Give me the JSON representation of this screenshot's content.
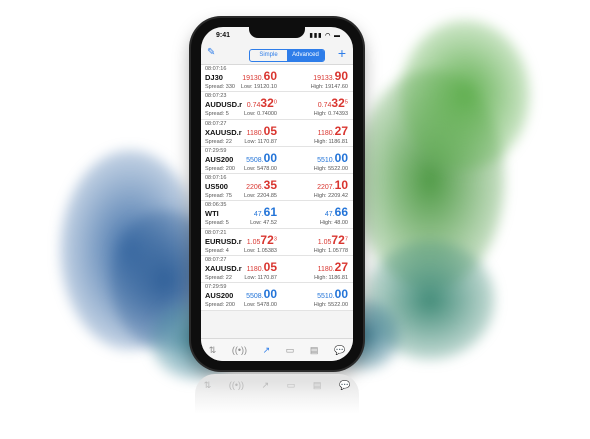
{
  "status": {
    "time": "9:41",
    "icons": "▮▮▮ ◠ ▬"
  },
  "toolbar": {
    "edit_icon": "✎",
    "tab_simple": "Simple",
    "tab_advanced": "Advanced",
    "add_icon": "+"
  },
  "quotes": [
    {
      "time": "08:07:16",
      "symbol": "DJ30",
      "spread": "Spread: 330",
      "bid_small": "19130.",
      "bid_big": "60",
      "bid_sup": "",
      "ask_small": "19133.",
      "ask_big": "90",
      "ask_sup": "",
      "low": "Low: 19120.10",
      "high": "High: 19147.60",
      "color": "red"
    },
    {
      "time": "08:07:23",
      "symbol": "AUDUSD.r",
      "spread": "Spread: 5",
      "bid_small": "0.74",
      "bid_big": "32",
      "bid_sup": "0",
      "ask_small": "0.74",
      "ask_big": "32",
      "ask_sup": "5",
      "low": "Low: 0.74000",
      "high": "High: 0.74393",
      "color": "red"
    },
    {
      "time": "08:07:27",
      "symbol": "XAUUSD.r",
      "spread": "Spread: 22",
      "bid_small": "1180.",
      "bid_big": "05",
      "bid_sup": "",
      "ask_small": "1180.",
      "ask_big": "27",
      "ask_sup": "",
      "low": "Low: 1170.87",
      "high": "High: 1186.81",
      "color": "red"
    },
    {
      "time": "07:29:59",
      "symbol": "AUS200",
      "spread": "Spread: 200",
      "bid_small": "5508.",
      "bid_big": "00",
      "bid_sup": "",
      "ask_small": "5510.",
      "ask_big": "00",
      "ask_sup": "",
      "low": "Low: 5478.00",
      "high": "High: 5522.00",
      "color": "blue"
    },
    {
      "time": "08:07:16",
      "symbol": "US500",
      "spread": "Spread: 75",
      "bid_small": "2206.",
      "bid_big": "35",
      "bid_sup": "",
      "ask_small": "2207.",
      "ask_big": "10",
      "ask_sup": "",
      "low": "Low: 2204.85",
      "high": "High: 2209.42",
      "color": "red"
    },
    {
      "time": "08:06:35",
      "symbol": "WTI",
      "spread": "Spread: 5",
      "bid_small": "47.",
      "bid_big": "61",
      "bid_sup": "",
      "ask_small": "47.",
      "ask_big": "66",
      "ask_sup": "",
      "low": "Low: 47.52",
      "high": "High: 48.00",
      "color": "blue"
    },
    {
      "time": "08:07:21",
      "symbol": "EURUSD.r",
      "spread": "Spread: 4",
      "bid_small": "1.05",
      "bid_big": "72",
      "bid_sup": "3",
      "ask_small": "1.05",
      "ask_big": "72",
      "ask_sup": "7",
      "low": "Low: 1.05383",
      "high": "High: 1.05778",
      "color": "red"
    },
    {
      "time": "08:07:27",
      "symbol": "XAUUSD.r",
      "spread": "Spread: 22",
      "bid_small": "1180.",
      "bid_big": "05",
      "bid_sup": "",
      "ask_small": "1180.",
      "ask_big": "27",
      "ask_sup": "",
      "low": "Low: 1170.87",
      "high": "High: 1186.81",
      "color": "red"
    },
    {
      "time": "07:29:59",
      "symbol": "AUS200",
      "spread": "Spread: 200",
      "bid_small": "5508.",
      "bid_big": "00",
      "bid_sup": "",
      "ask_small": "5510.",
      "ask_big": "00",
      "ask_sup": "",
      "low": "Low: 5478.00",
      "high": "High: 5522.00",
      "color": "blue"
    }
  ],
  "tabbar": {
    "quotes_icon": "⇅",
    "chart_icon": "((•))",
    "trade_icon": "↗",
    "history_icon": "▭",
    "news_icon": "▤",
    "messages_icon": "💬"
  },
  "colors": {
    "accent": "#2e7de9",
    "up": "#d9352f",
    "down": "#2374d8",
    "splash_blue": "#3f6fa8",
    "splash_green": "#4f9a45"
  }
}
